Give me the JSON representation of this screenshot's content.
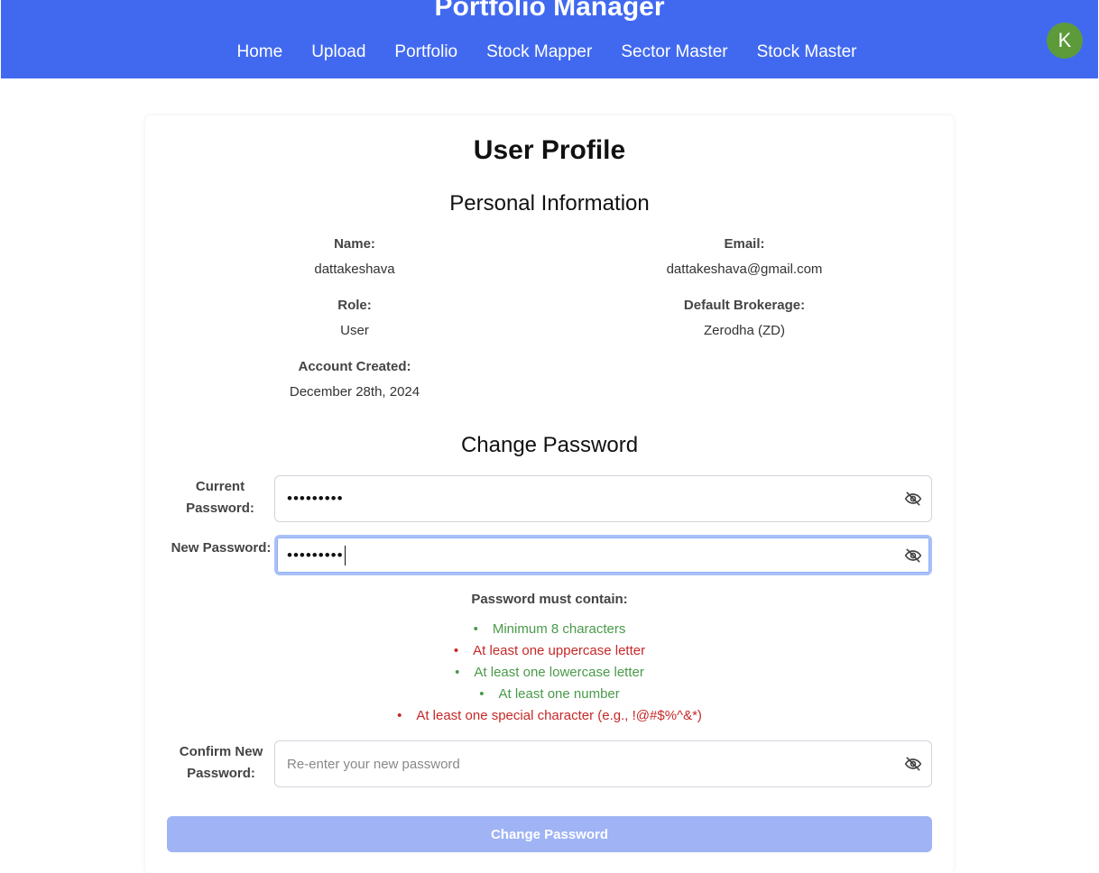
{
  "app": {
    "title": "Portfolio Manager",
    "avatar_letter": "K"
  },
  "nav": {
    "items": [
      "Home",
      "Upload",
      "Portfolio",
      "Stock Mapper",
      "Sector Master",
      "Stock Master"
    ]
  },
  "profile": {
    "page_title": "User Profile",
    "personal_title": "Personal Information",
    "name_label": "Name:",
    "name_value": "dattakeshava",
    "email_label": "Email:",
    "email_value": "dattakeshava@gmail.com",
    "role_label": "Role:",
    "role_value": "User",
    "brokerage_label": "Default Brokerage:",
    "brokerage_value": "Zerodha (ZD)",
    "created_label": "Account Created:",
    "created_value": "December 28th, 2024"
  },
  "password": {
    "section_title": "Change Password",
    "current_label_1": "Current",
    "current_label_2": "Password:",
    "current_value": "•••••••••",
    "new_label": "New Password:",
    "new_value": "•••••••••",
    "confirm_label_1": "Confirm New",
    "confirm_label_2": "Password:",
    "confirm_placeholder": "Re-enter your new password",
    "requirements_title": "Password must contain:",
    "requirements": [
      {
        "text": "Minimum 8 characters",
        "met": true
      },
      {
        "text": "At least one uppercase letter",
        "met": false
      },
      {
        "text": "At least one lowercase letter",
        "met": true
      },
      {
        "text": "At least one number",
        "met": true
      },
      {
        "text": "At least one special character (e.g., !@#$%^&*)",
        "met": false
      }
    ],
    "submit_label": "Change Password"
  },
  "colors": {
    "header": "#4169f0",
    "avatar": "#5d9a3a",
    "requirement_met": "#4a9a4a",
    "requirement_unmet": "#c62828",
    "submit_disabled": "#9fb3f5"
  }
}
